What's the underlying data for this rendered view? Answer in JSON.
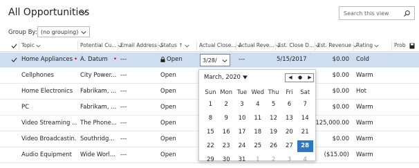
{
  "view": {
    "title": "All Opportunities"
  },
  "search": {
    "placeholder": "Search this view"
  },
  "group_by": {
    "label": "Group By:",
    "value": "(no grouping)"
  },
  "columns": [
    "Topic",
    "Potential Cu...",
    "Email Address",
    "Status",
    "Actual Close...",
    "Actual Reve...",
    "Est. Close D...",
    "Est. Revenue",
    "Rating",
    "Prob"
  ],
  "rows": [
    {
      "topic": "Home Appliances",
      "customer": "A. Datum",
      "email": "---",
      "status": "Open",
      "actual_close": "3/28/",
      "actual_revenue": "---",
      "est_close": "5/15/2017",
      "est_revenue": "$0.00",
      "rating": "Cold"
    },
    {
      "topic": "Cellphones",
      "customer": "City Power...",
      "email": "---",
      "status": "Open",
      "actual_close": "",
      "actual_revenue": "",
      "est_close": "",
      "est_revenue": "$0.00",
      "rating": "Warm"
    },
    {
      "topic": "Home Electronics",
      "customer": "Fabrikam, ...",
      "email": "---",
      "status": "Open",
      "actual_close": "",
      "actual_revenue": "",
      "est_close": "",
      "est_revenue": "$0.00",
      "rating": "Hot"
    },
    {
      "topic": "PC",
      "customer": "Fabrikam, ...",
      "email": "---",
      "status": "Open",
      "actual_close": "",
      "actual_revenue": "",
      "est_close": "",
      "est_revenue": "$0.00",
      "rating": "Warm"
    },
    {
      "topic": "Video Streaming ...",
      "customer": "The Phone...",
      "email": "---",
      "status": "Open",
      "actual_close": "",
      "actual_revenue": "",
      "est_close": "",
      "est_revenue": "$125,000.00",
      "rating": "Warm"
    },
    {
      "topic": "Video Broadcastin...",
      "customer": "Southridg...",
      "email": "---",
      "status": "Open",
      "actual_close": "",
      "actual_revenue": "",
      "est_close": "",
      "est_revenue": "$0.00",
      "rating": "Warm"
    },
    {
      "topic": "Audio Equipment",
      "customer": "Wide Worl...",
      "email": "---",
      "status": "Open",
      "actual_close": "",
      "actual_revenue": "",
      "est_close": "",
      "est_revenue": "($15.00)",
      "rating": "Warm"
    }
  ],
  "calendar": {
    "month_label": "March, 2020",
    "weekdays": [
      "Sun",
      "Mon",
      "Tue",
      "Wed",
      "Thu",
      "Fri",
      "Sat"
    ],
    "weeks": [
      [
        "1",
        "2",
        "3",
        "4",
        "5",
        "6",
        "7"
      ],
      [
        "8",
        "9",
        "10",
        "11",
        "12",
        "13",
        "14"
      ],
      [
        "15",
        "16",
        "17",
        "18",
        "19",
        "20",
        "21"
      ],
      [
        "22",
        "23",
        "24",
        "25",
        "26",
        "27",
        "28"
      ],
      [
        "29",
        "30",
        "31",
        "1",
        "2",
        "3",
        "4"
      ]
    ],
    "selected": "28",
    "colors": {
      "selected_bg": "#2b78c4",
      "row_selected_bg": "#cfddf0"
    }
  }
}
